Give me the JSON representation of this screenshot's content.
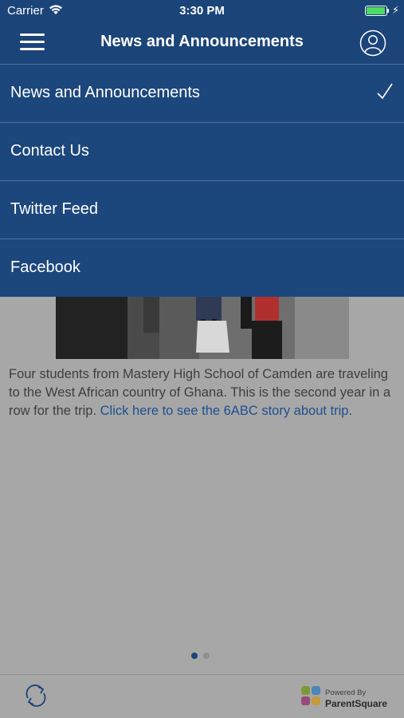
{
  "status_bar": {
    "carrier": "Carrier",
    "time": "3:30 PM",
    "battery_level": 1.0
  },
  "nav": {
    "title": "News and Announcements",
    "menu_icon": "hamburger-menu-icon",
    "profile_icon": "user-profile-icon"
  },
  "menu": {
    "items": [
      {
        "label": "News and Announcements",
        "selected": true
      },
      {
        "label": "Contact Us",
        "selected": false
      },
      {
        "label": "Twitter Feed",
        "selected": false
      },
      {
        "label": "Facebook",
        "selected": false
      }
    ]
  },
  "article": {
    "body": "Four students from Mastery High School of Camden are traveling to the West African country of Ghana. This is the second year in a row for the trip.",
    "link_text": "Click here to see the 6ABC story about trip."
  },
  "pager": {
    "count": 2,
    "active": 1
  },
  "footer": {
    "refresh_icon": "refresh-icon",
    "powered_by": "Powered By",
    "brand": "ParentSquare"
  },
  "colors": {
    "primary": "#1b4479",
    "menu_bg": "#1c477c",
    "overlay_bg": "#a7a7a7",
    "link": "#1f4f90"
  }
}
